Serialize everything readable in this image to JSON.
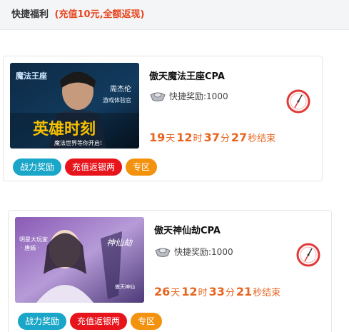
{
  "header": {
    "title": "快捷福利",
    "subtitle": "(充值10元,全额返现)"
  },
  "offers": [
    {
      "name": "傲天魔法王座CPA",
      "reward_label": "快捷奖励:1000",
      "banner": {
        "logo": "魔法王座",
        "star": "周杰伦",
        "role": "游戏体验官",
        "slogan": "英雄时刻",
        "tagline": "魔法世界等你开启!"
      },
      "countdown": {
        "days": "19",
        "days_unit": "天",
        "hours": "12",
        "hours_unit": "时",
        "minutes": "37",
        "minutes_unit": "分",
        "seconds": "27",
        "seconds_unit": "秒结束"
      },
      "tags": [
        "战力奖励",
        "充值返银两",
        "专区"
      ]
    },
    {
      "name": "傲天神仙劫CPA",
      "reward_label": "快捷奖励:1000",
      "banner": {
        "caption1": "明星大玩家",
        "caption2": "· 唐嫣 ·",
        "logo": "神仙劫",
        "tagline": "傲天神仙"
      },
      "countdown": {
        "days": "26",
        "days_unit": "天",
        "hours": "12",
        "hours_unit": "时",
        "minutes": "33",
        "minutes_unit": "分",
        "seconds": "21",
        "seconds_unit": "秒结束"
      },
      "tags": [
        "战力奖励",
        "充值返银两",
        "专区"
      ]
    }
  ],
  "icons": {
    "reward": "silver-ingot-icon",
    "timer": "compass-clock-icon"
  },
  "colors": {
    "accent": "#e8641e",
    "tag_blue": "#1aa6c8",
    "tag_red": "#e8141c",
    "tag_orange": "#f3920f"
  }
}
